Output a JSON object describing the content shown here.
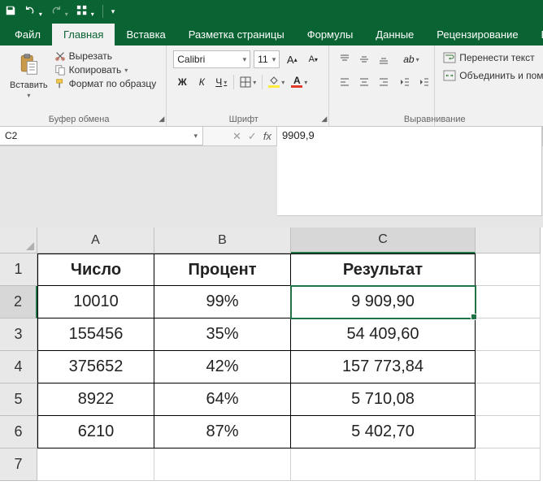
{
  "qat": {
    "save": "save-icon",
    "undo": "undo-icon",
    "redo": "redo-icon",
    "touch": "touch-mode-icon"
  },
  "tabs": {
    "file": "Файл",
    "home": "Главная",
    "insert": "Вставка",
    "pagelayout": "Разметка страницы",
    "formulas": "Формулы",
    "data": "Данные",
    "review": "Рецензирование",
    "view": "Вид"
  },
  "clipboard": {
    "paste": "Вставить",
    "cut": "Вырезать",
    "copy": "Копировать",
    "format_painter": "Формат по образцу",
    "group": "Буфер обмена"
  },
  "font": {
    "name": "Calibri",
    "size": "11",
    "group": "Шрифт",
    "bold": "Ж",
    "italic": "К",
    "underline": "Ч",
    "increase": "A",
    "decrease": "A"
  },
  "align": {
    "group": "Выравнивание",
    "wrap": "Перенести текст",
    "merge": "Объединить и помес"
  },
  "namebox": "C2",
  "formula_value": "9909,9",
  "cols": [
    "A",
    "B",
    "C"
  ],
  "grid": {
    "headers": [
      "Число",
      "Процент",
      "Результат"
    ],
    "rows": [
      {
        "n": "10010",
        "p": "99%",
        "r": "9 909,90"
      },
      {
        "n": "155456",
        "p": "35%",
        "r": "54 409,60"
      },
      {
        "n": "375652",
        "p": "42%",
        "r": "157 773,84"
      },
      {
        "n": "8922",
        "p": "64%",
        "r": "5 710,08"
      },
      {
        "n": "6210",
        "p": "87%",
        "r": "5 402,70"
      }
    ]
  },
  "active": {
    "col": "C",
    "row": 2
  }
}
